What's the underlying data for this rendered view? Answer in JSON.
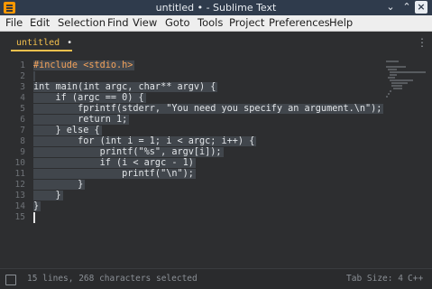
{
  "window": {
    "title": "untitled • - Sublime Text"
  },
  "menu": [
    "File",
    "Edit",
    "Selection",
    "Find",
    "View",
    "Goto",
    "Tools",
    "Project",
    "Preferences",
    "Help"
  ],
  "tab": {
    "label": "untitled",
    "dirty": "•",
    "menu_glyph": "⋮"
  },
  "gutter": [
    "1",
    "2",
    "3",
    "4",
    "5",
    "6",
    "7",
    "8",
    "9",
    "10",
    "11",
    "12",
    "13",
    "14",
    "15"
  ],
  "code": [
    "#include <stdio.h>",
    "",
    "int main(int argc, char** argv) {",
    "    if (argc == 0) {",
    "        fprintf(stderr, \"You need you specify an argument.\\n\");",
    "        return 1;",
    "    } else {",
    "        for (int i = 1; i < argc; i++) {",
    "            printf(\"%s\", argv[i]);",
    "            if (i < argc - 1)",
    "                printf(\"\\n\");",
    "        }",
    "    }",
    "}",
    ""
  ],
  "status": {
    "selection": "15 lines, 268 characters selected",
    "tab_size": "Tab Size: 4",
    "syntax": "C++"
  },
  "colors": {
    "titlebar": "#2f3b4c",
    "accent_tab": "#f3c04d",
    "editor_bg": "#2d2e30",
    "selection": "#41464c"
  }
}
